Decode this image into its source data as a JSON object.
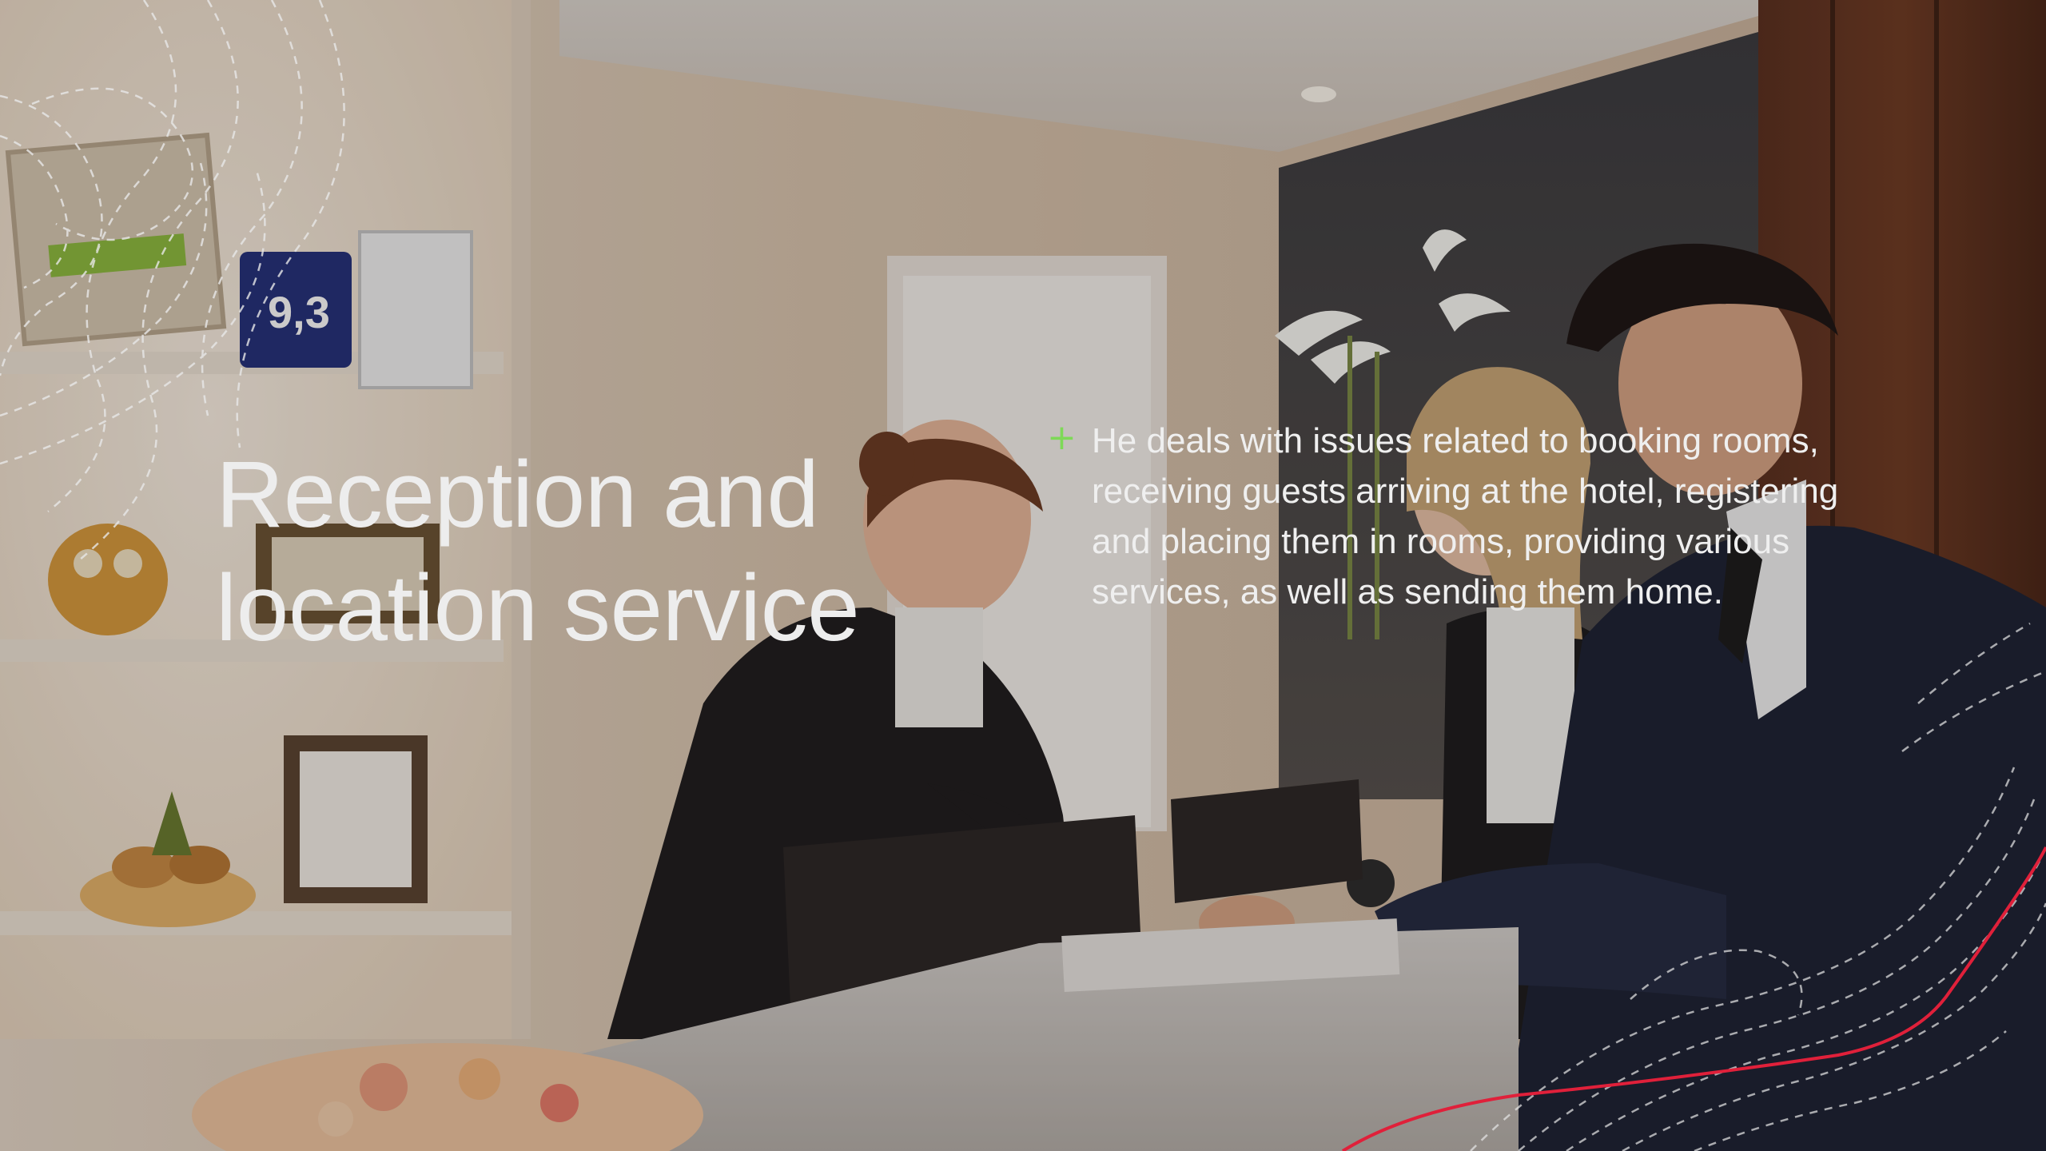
{
  "slide": {
    "title": "Reception and location service",
    "bullet": {
      "icon": "plus-icon",
      "text": "He deals with issues related to booking rooms, receiving guests arriving at the hotel, registering and placing them in rooms, providing various services, as well as sending them home."
    },
    "colors": {
      "title_text": "#ededed",
      "body_text": "#efefef",
      "bullet_accent": "#7ed957",
      "decor_line": "#e8e8e8",
      "accent_line": "#e0203a"
    }
  }
}
